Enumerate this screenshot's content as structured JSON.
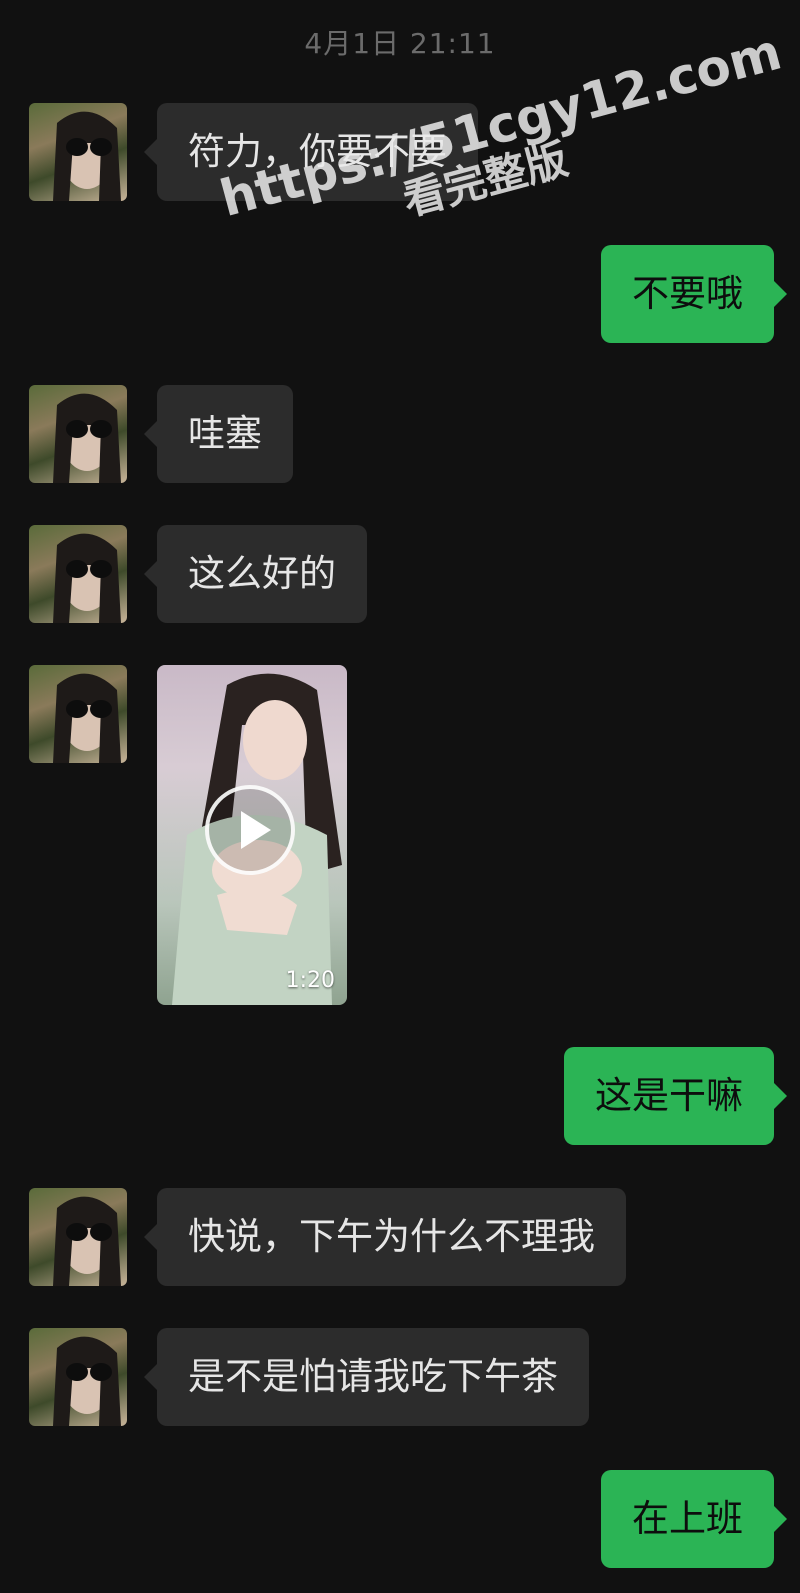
{
  "timestamp": "4月1日 21:11",
  "messages": [
    {
      "side": "left",
      "text": "符力，你要不要"
    },
    {
      "side": "right",
      "text": "不要哦"
    },
    {
      "side": "left",
      "text": "哇塞"
    },
    {
      "side": "left",
      "text": "这么好的"
    },
    {
      "side": "left",
      "type": "video",
      "duration": "1:20"
    },
    {
      "side": "right",
      "text": "这是干嘛"
    },
    {
      "side": "left",
      "text": "快说，下午为什么不理我"
    },
    {
      "side": "left",
      "text": "是不是怕请我吃下午茶"
    },
    {
      "side": "right",
      "text": "在上班"
    }
  ],
  "watermark": {
    "url": "https://51cgy12.com",
    "subtitle": "看完整版"
  },
  "colors": {
    "background": "#111111",
    "incoming_bubble": "#2c2c2c",
    "outgoing_bubble": "#2bb455"
  }
}
